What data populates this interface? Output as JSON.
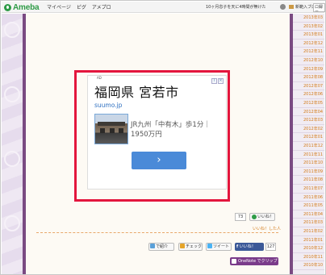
{
  "topbar": {
    "logo": "Ameba",
    "nav": [
      "マイページ",
      "ピグ",
      "アメプロ"
    ],
    "news": "10ヶ月息子を天に4時間が無けた",
    "new_blog": "新範入ブログ",
    "login": "ロ録ロ"
  },
  "ad": {
    "label": "AD",
    "title": "福岡県 宮若市",
    "url": "suumo.jp",
    "description": "JR九州「中有木」歩1分｜1950万円",
    "button_glyph": "›",
    "icon_info": "i",
    "icon_close": "×"
  },
  "actions": {
    "like_count": "73",
    "like_label": "いいね！",
    "reader_link": "いいね！した人",
    "share_buttons": [
      {
        "label": "で紹介"
      },
      {
        "label": "チェック"
      },
      {
        "label": "ツイート"
      }
    ],
    "facebook_label": "いいね！",
    "facebook_count": "127",
    "onenote_label": "OneNote でクリップ"
  },
  "archive": {
    "items": [
      "2013年03",
      "2013年02",
      "2013年01",
      "2012年12",
      "2012年11",
      "2012年10",
      "2012年09",
      "2012年08",
      "2012年07",
      "2012年06",
      "2012年05",
      "2012年04",
      "2012年03",
      "2012年02",
      "2012年01",
      "2011年12",
      "2011年11",
      "2011年10",
      "2011年09",
      "2011年08",
      "2011年07",
      "2011年06",
      "2011年05",
      "2011年04",
      "2011年03",
      "2011年02",
      "2011年01",
      "2010年12",
      "2010年11",
      "2010年10"
    ]
  },
  "colors": {
    "ad_outline": "#e3163d",
    "rail": "#7a4a82",
    "archive_link": "#d37a18",
    "ameba_green": "#2e9b46",
    "facebook": "#3b5998"
  }
}
